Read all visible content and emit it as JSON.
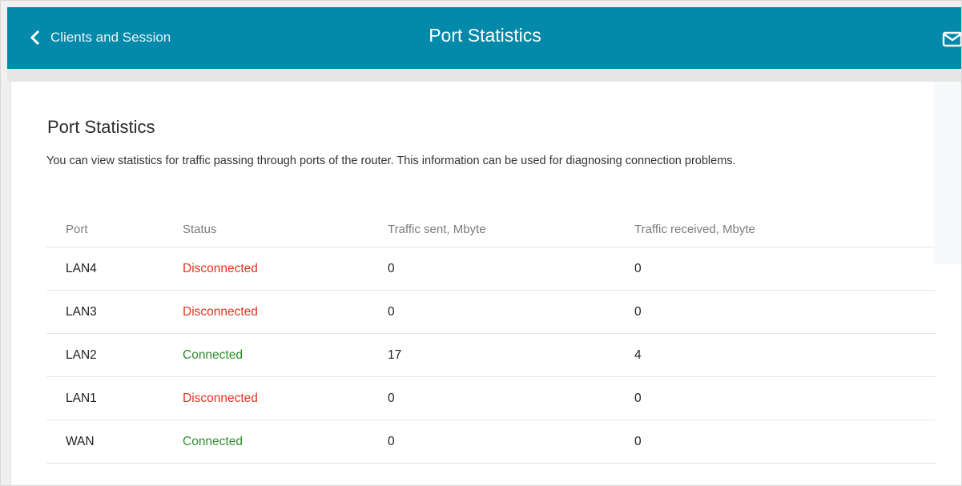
{
  "header": {
    "back_label": "Clients and Session",
    "title": "Port Statistics",
    "mail_icon": "mail-icon",
    "back_icon": "chevron-left-icon"
  },
  "colors": {
    "header_bg": "#0389a9",
    "disconnected": "#e3341d",
    "connected": "#2e8f2e"
  },
  "page": {
    "heading": "Port Statistics",
    "description": "You can view statistics for traffic passing through ports of the router. This information can be used for diagnosing connection problems."
  },
  "table": {
    "columns": [
      "Port",
      "Status",
      "Traffic sent, Mbyte",
      "Traffic received, Mbyte"
    ],
    "rows": [
      {
        "port": "LAN4",
        "status": "Disconnected",
        "sent": "0",
        "received": "0"
      },
      {
        "port": "LAN3",
        "status": "Disconnected",
        "sent": "0",
        "received": "0"
      },
      {
        "port": "LAN2",
        "status": "Connected",
        "sent": "17",
        "received": "4"
      },
      {
        "port": "LAN1",
        "status": "Disconnected",
        "sent": "0",
        "received": "0"
      },
      {
        "port": "WAN",
        "status": "Connected",
        "sent": "0",
        "received": "0"
      }
    ]
  }
}
